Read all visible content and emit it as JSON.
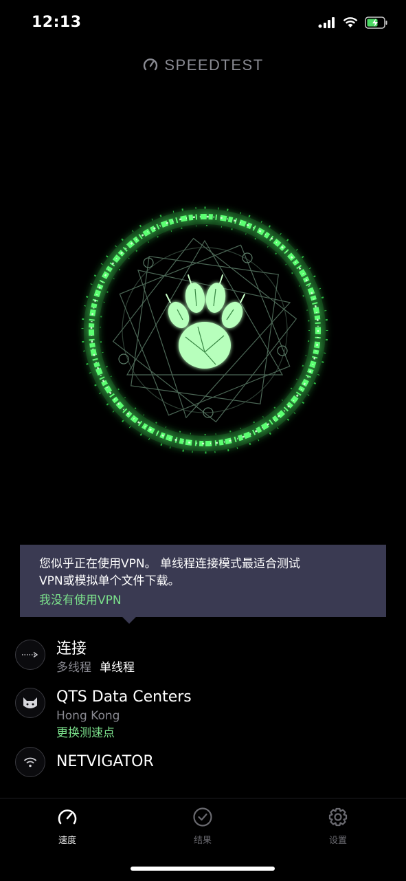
{
  "status_bar": {
    "time": "12:13"
  },
  "brand": {
    "name": "SPEEDTEST"
  },
  "tooltip": {
    "line1": "您似乎正在使用VPN。 单线程连接模式最适合测试",
    "line2": "VPN或模拟单个文件下载。",
    "link": "我没有使用VPN"
  },
  "connection": {
    "title": "连接",
    "option_multi": "多线程",
    "option_single": "单线程"
  },
  "server": {
    "title": "QTS Data Centers",
    "location": "Hong Kong",
    "change_label": "更换测速点"
  },
  "network": {
    "title": "NETVIGATOR"
  },
  "tabs": [
    {
      "label": "速度",
      "icon": "speedometer-icon"
    },
    {
      "label": "结果",
      "icon": "check-circle-icon"
    },
    {
      "label": "设置",
      "icon": "gear-icon"
    }
  ],
  "colors": {
    "accent_green": "#7be08b",
    "tooltip_bg": "#3a3a52",
    "ring_green": "#3cff5a"
  }
}
